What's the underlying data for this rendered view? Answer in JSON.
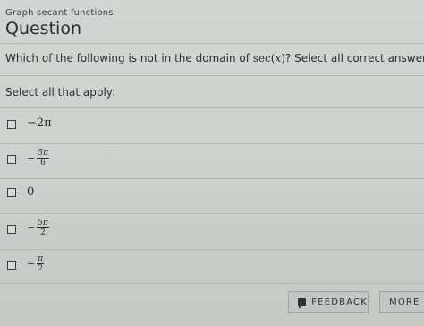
{
  "header": {
    "topic": "Graph secant functions",
    "section_title": "Question"
  },
  "question": {
    "prompt_before": "Which of the following is not in the domain of ",
    "prompt_math_fn": "sec(",
    "prompt_math_var": "x",
    "prompt_math_close": ")",
    "prompt_after": "? Select all correct answers."
  },
  "select_label": "Select all that apply:",
  "options": [
    {
      "label": "−2π"
    },
    {
      "sign": "−",
      "numerator": "5π",
      "denominator": "6"
    },
    {
      "label": "0"
    },
    {
      "sign": "−",
      "numerator": "5π",
      "denominator": "2"
    },
    {
      "sign": "−",
      "numerator": "π",
      "denominator": "2"
    }
  ],
  "footer": {
    "feedback_label": "FEEDBACK",
    "more_label": "MORE I"
  }
}
